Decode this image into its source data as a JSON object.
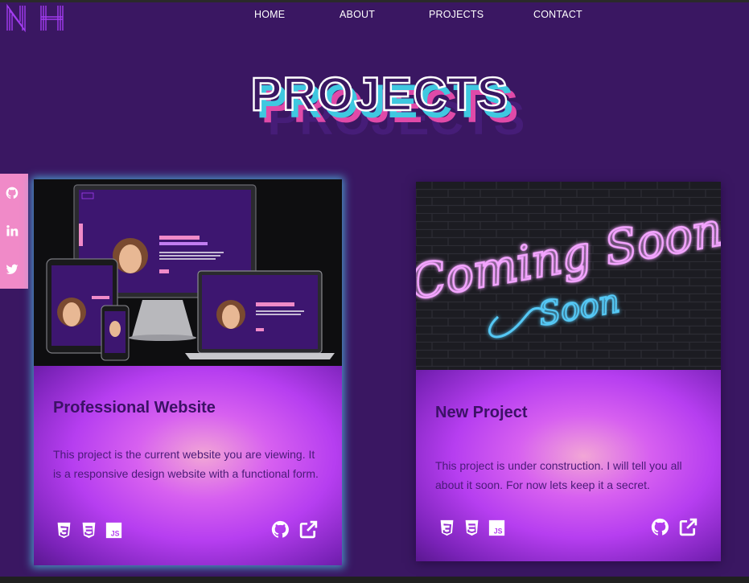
{
  "brand": {
    "logo_text": "NH"
  },
  "nav": {
    "home": "HOME",
    "about": "ABOUT",
    "projects": "PROJECTS",
    "contact": "CONTACT"
  },
  "page": {
    "title": "PROJECTS"
  },
  "social": [
    "github-icon",
    "linkedin-icon",
    "twitter-icon"
  ],
  "colors": {
    "background": "#3a1762",
    "accent_pink": "#f08ac8",
    "accent_cyan": "#3fc8e0",
    "card_glow": "#50bee6"
  },
  "projects": [
    {
      "title": "Professional Website",
      "description": "This project is the current website you are viewing. It is a responsive design website with a functional form.",
      "tech_icons": [
        "html5-icon",
        "css3-icon",
        "js-icon"
      ],
      "link_icons": [
        "github-icon",
        "external-link-icon"
      ]
    },
    {
      "title": "New Project",
      "description": "This project is under construction. I will tell you all about it soon. For now lets keep it a secret.",
      "tech_icons": [
        "html5-icon",
        "css3-icon",
        "js-icon"
      ],
      "link_icons": [
        "github-icon",
        "external-link-icon"
      ],
      "image_text": "Coming Soon"
    }
  ]
}
